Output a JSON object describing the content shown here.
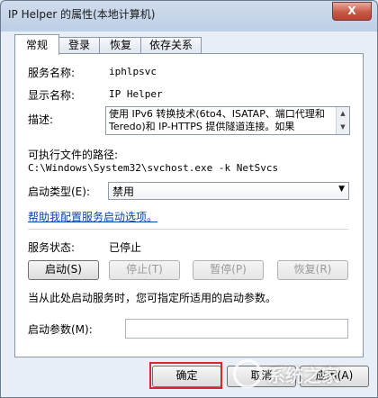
{
  "window": {
    "title": "IP Helper 的属性(本地计算机)",
    "close_glyph": "X"
  },
  "tabs": [
    {
      "label": "常规",
      "active": true
    },
    {
      "label": "登录",
      "active": false
    },
    {
      "label": "恢复",
      "active": false
    },
    {
      "label": "依存关系",
      "active": false
    }
  ],
  "general": {
    "service_name_label": "服务名称:",
    "service_name_value": "iphlpsvc",
    "display_name_label": "显示名称:",
    "display_name_value": "IP Helper",
    "description_label": "描述:",
    "description_value": "使用 IPv6 转换技术(6to4、ISATAP、端口代理和 Teredo)和 IP-HTTPS 提供隧道连接。如果",
    "exe_path_label": "可执行文件的路径:",
    "exe_path_value": "C:\\Windows\\System32\\svchost.exe -k NetSvcs",
    "startup_type_label": "启动类型(E):",
    "startup_type_value": "禁用",
    "help_link": "帮助我配置服务启动选项。",
    "status_label": "服务状态:",
    "status_value": "已停止",
    "buttons": {
      "start": "启动(S)",
      "stop": "停止(T)",
      "pause": "暂停(P)",
      "resume": "恢复(R)"
    },
    "hint": "当从此处启动服务时，您可指定所适用的启动参数。",
    "params_label": "启动参数(M):",
    "params_value": ""
  },
  "footer": {
    "ok": "确定",
    "cancel": "取消",
    "apply": "应用(A)"
  },
  "watermark": {
    "text": "系统之家"
  },
  "colors": {
    "highlight": "#d9282c",
    "link": "#0645ad"
  }
}
